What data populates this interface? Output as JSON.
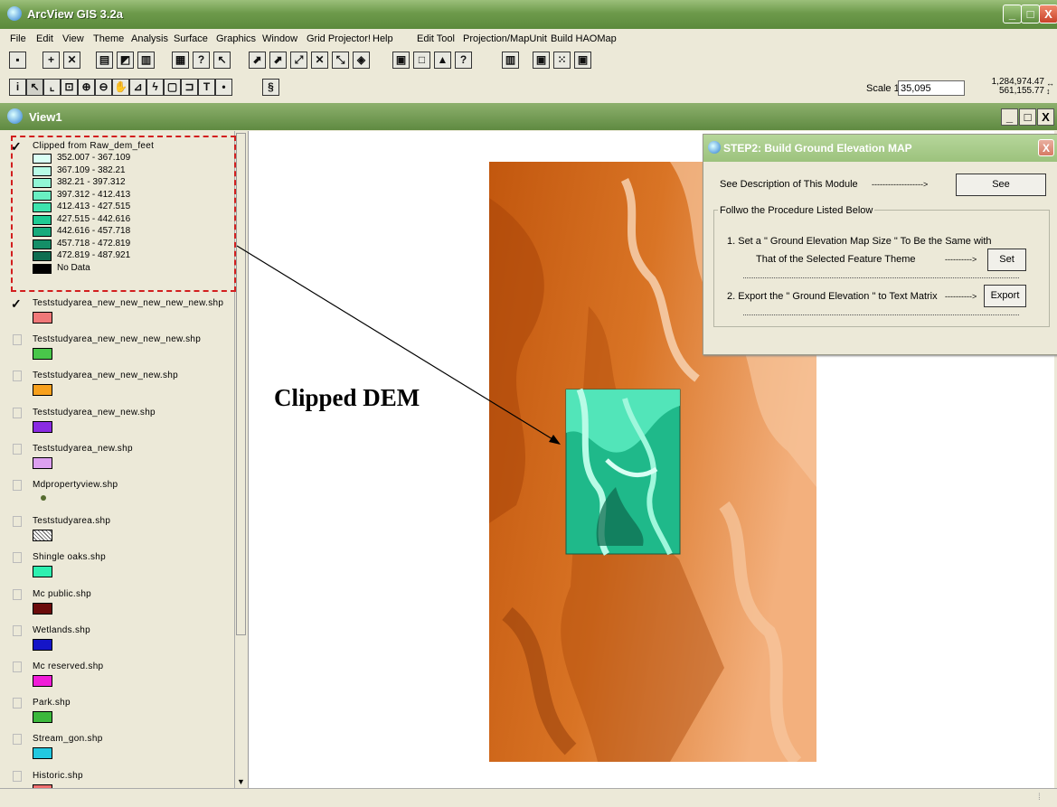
{
  "app": {
    "title": "ArcView GIS 3.2a",
    "window_buttons": [
      "_",
      "□",
      "X"
    ]
  },
  "menu": [
    "File",
    "Edit",
    "View",
    "Theme",
    "Analysis",
    "Surface",
    "Graphics",
    "Window",
    "Grid Projector!",
    "Help",
    "Edit Tool",
    "Projection/MapUnit",
    "Build HAOMap"
  ],
  "scale": {
    "label": "Scale 1:",
    "value": "35,095"
  },
  "coords": {
    "x": "1,284,974.47",
    "y": "561,155.77"
  },
  "view": {
    "title": "View1",
    "buttons": [
      "_",
      "□",
      "X"
    ]
  },
  "legend": {
    "dem_theme": "Clipped from Raw_dem_feet",
    "classes": [
      {
        "label": "352.007 - 367.109",
        "color": "#d9fff4"
      },
      {
        "label": "367.109 - 382.21",
        "color": "#b8fbe6"
      },
      {
        "label": "382.21 - 397.312",
        "color": "#91f6d5"
      },
      {
        "label": "397.312 - 412.413",
        "color": "#69efc2"
      },
      {
        "label": "412.413 - 427.515",
        "color": "#3ee4ad"
      },
      {
        "label": "427.515 - 442.616",
        "color": "#1ecb93"
      },
      {
        "label": "442.616 - 457.718",
        "color": "#18ab7c"
      },
      {
        "label": "457.718 - 472.819",
        "color": "#148e67"
      },
      {
        "label": "472.819 - 487.921",
        "color": "#0f6e50"
      },
      {
        "label": "No Data",
        "color": "#000000"
      }
    ],
    "themes": [
      {
        "name": "Teststudyarea_new_new_new_new_new.shp",
        "color": "#f07878",
        "checked": true
      },
      {
        "name": "Teststudyarea_new_new_new_new.shp",
        "color": "#49c74a",
        "checked": false
      },
      {
        "name": "Teststudyarea_new_new_new.shp",
        "color": "#f7a01c",
        "checked": false
      },
      {
        "name": "Teststudyarea_new_new.shp",
        "color": "#8a2be2",
        "checked": false
      },
      {
        "name": "Teststudyarea_new.shp",
        "color": "#dda0f0",
        "checked": false
      },
      {
        "name": "Mdpropertyview.shp",
        "color": "#556b2f",
        "checked": false,
        "symbol": "point"
      },
      {
        "name": "Teststudyarea.shp",
        "color": "#cccccc",
        "checked": false,
        "symbol": "hatch"
      },
      {
        "name": "Shingle oaks.shp",
        "color": "#2ef0b0",
        "checked": false
      },
      {
        "name": "Mc public.shp",
        "color": "#6b0b0b",
        "checked": false
      },
      {
        "name": "Wetlands.shp",
        "color": "#1515c8",
        "checked": false
      },
      {
        "name": "Mc reserved.shp",
        "color": "#f01cd8",
        "checked": false
      },
      {
        "name": "Park.shp",
        "color": "#3cb83c",
        "checked": false
      },
      {
        "name": "Stream_gon.shp",
        "color": "#22c8e0",
        "checked": false
      },
      {
        "name": "Historic.shp",
        "color": "#f07070",
        "checked": false
      }
    ]
  },
  "annotation": {
    "label": "Clipped DEM",
    "highlight_color": "#d21e1e"
  },
  "dialog": {
    "title": "STEP2: Build Ground Elevation MAP",
    "close": "X",
    "desc_text": "See Description of This Module",
    "desc_arrow": "------------------->",
    "see_button": "See",
    "group_label": "Follwo the Procedure Listed Below",
    "step1_line1": "1. Set  a \" Ground Elevation Map Size \" To Be the Same with",
    "step1_line2": "That of the Selected Feature Theme",
    "step1_arrow": "---------->",
    "set_button": "Set",
    "step2_text": "2. Export the \" Ground Elevation \" to Text Matrix",
    "step2_arrow": "---------->",
    "export_button": "Export"
  }
}
